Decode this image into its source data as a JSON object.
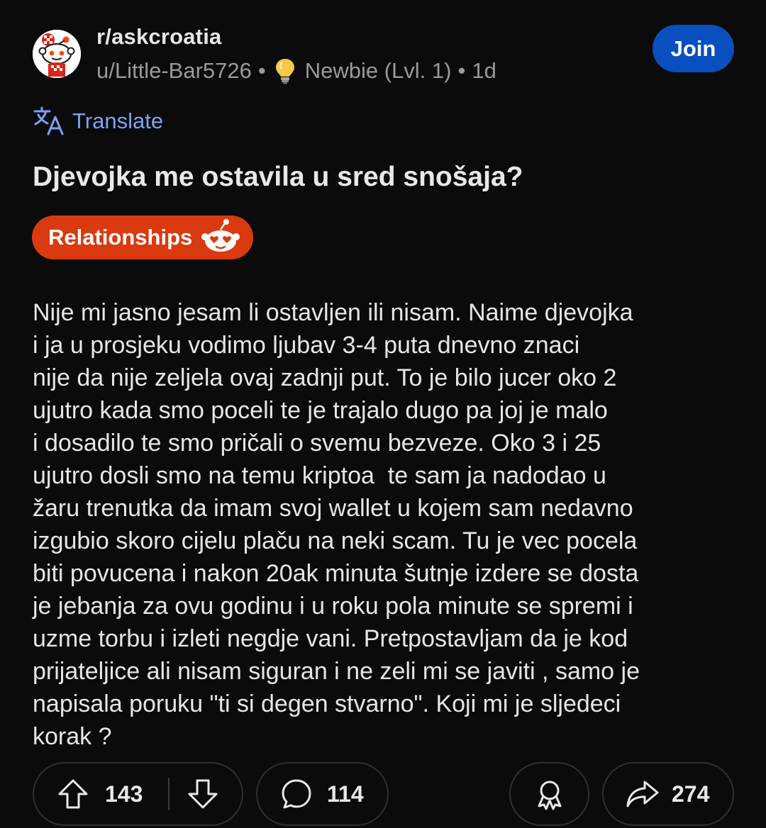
{
  "post": {
    "subreddit": "r/askcroatia",
    "author": "u/Little-Bar5726",
    "separator": "•",
    "user_flair": "Newbie (Lvl. 1)",
    "age": "1d",
    "join_label": "Join",
    "translate_label": "Translate",
    "title": "Djevojka me ostavila u sred snošaja?",
    "flair": "Relationships",
    "body_lines": [
      "Nije mi jasno jesam li ostavljen ili nisam. Naime djevojka",
      "i ja u prosjeku vodimo ljubav 3-4 puta dnevno znaci",
      "nije da nije zeljela ovaj zadnji put. To je bilo jucer oko 2",
      "ujutro kada smo poceli te je trajalo dugo pa joj je malo",
      "i dosadilo te smo pričali o svemu bezveze. Oko 3 i 25",
      "ujutro dosli smo na temu kriptoa  te sam ja nadodao u",
      "žaru trenutka da imam svoj wallet u kojem sam nedavno",
      "izgubio skoro cijelu plaču na neki scam. Tu je vec pocela",
      "biti povucena i nakon 20ak minuta šutnje izdere se dosta",
      "je jebanja za ovu godinu i u roku pola minute se spremi i",
      "uzme torbu i izleti negdje vani. Pretpostavljam da je kod",
      "prijateljice ali nisam siguran i ne zeli mi se javiti , samo je",
      "napisala poruku \"ti si degen stvarno\". Koji mi je sljedeci",
      "korak ?"
    ]
  },
  "actions": {
    "upvotes": "143",
    "comments": "114",
    "shares": "274"
  },
  "icons": {
    "avatar": "snoo-avatar-icon",
    "user_flair": "lightbulb-icon",
    "translate": "translate-icon",
    "flair_emoji": "snoo-heart-eyes-icon",
    "upvote": "upvote-arrow-icon",
    "downvote": "downvote-arrow-icon",
    "comment": "comment-bubble-icon",
    "award": "award-icon",
    "share": "share-arrow-icon"
  },
  "colors": {
    "background": "#0b0b0b",
    "join_button": "#0a4fbf",
    "flair": "#d93a0f",
    "translate": "#7aa3f5",
    "meta_text": "#9a9a9a"
  }
}
